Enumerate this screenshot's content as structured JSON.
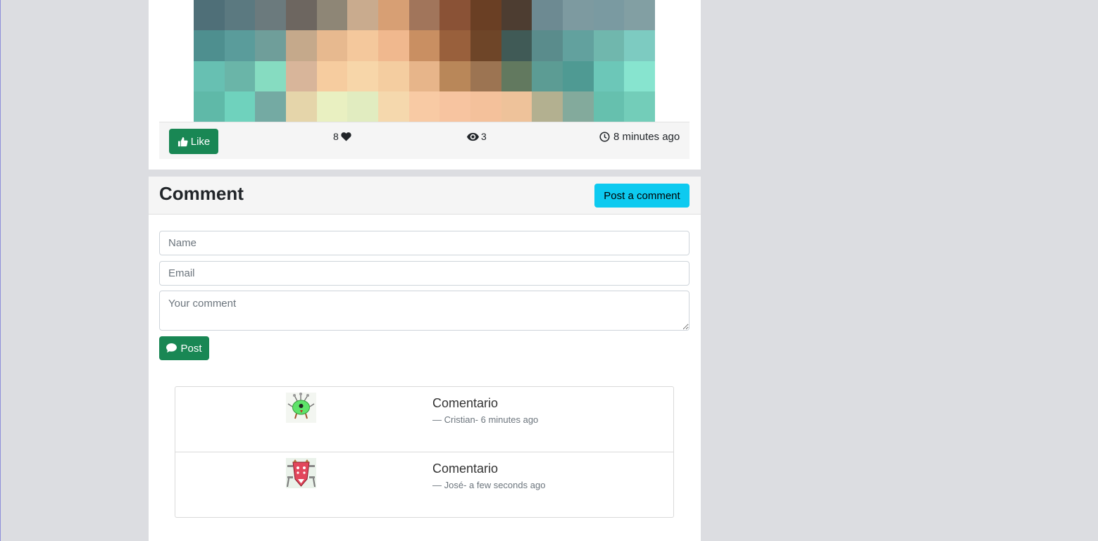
{
  "post": {
    "like_button_label": "Like",
    "likes_count": "8",
    "views_count": "3",
    "posted_time": "8 minutes ago"
  },
  "comments_section": {
    "title": "Comment",
    "post_comment_button": "Post a comment",
    "form": {
      "name_placeholder": "Name",
      "email_placeholder": "Email",
      "comment_placeholder": "Your comment",
      "post_button": "Post"
    },
    "items": [
      {
        "text": "Comentario",
        "author": "Cristian",
        "time": "6 minutes ago",
        "meta": "— Cristian- 6 minutes ago"
      },
      {
        "text": "Comentario",
        "author": "José",
        "time": "a few seconds ago",
        "meta": "— José- a few seconds ago"
      }
    ]
  },
  "colors": {
    "page_bg": "#dcdde1",
    "success": "#198754",
    "info": "#0dcaf0"
  },
  "icons": [
    "thumbs-up-icon",
    "heart-icon",
    "eye-icon",
    "clock-icon",
    "comment-icon"
  ]
}
